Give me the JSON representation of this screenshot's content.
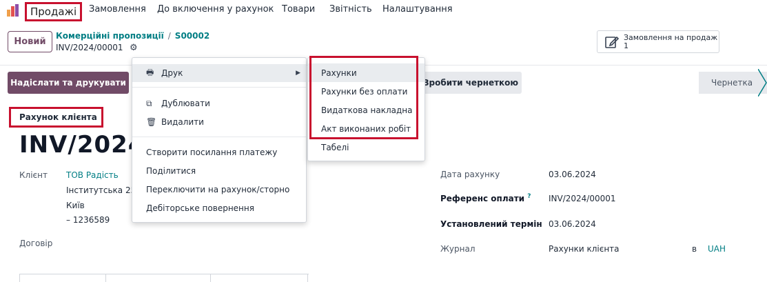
{
  "nav": {
    "app_name": "Продажі",
    "menu": [
      "Замовлення",
      "До включення у рахунок",
      "Товари",
      "Звітність",
      "Налаштування"
    ]
  },
  "control": {
    "new_label": "Новий",
    "breadcrumb_parent": "Комерційні пропозиції",
    "breadcrumb_separator": "/",
    "breadcrumb_current": "S00002",
    "record_name": "INV/2024/00001",
    "smart_button_label": "Замовлення на продаж",
    "smart_button_count": "1"
  },
  "actions": {
    "send_print": "Надіслати та друкувати",
    "reset_draft": "Зробити чернеткою",
    "status": "Чернетка"
  },
  "form": {
    "doc_type": "Рахунок клієнта",
    "title": "INV/2024/0",
    "customer_label": "Клієнт",
    "customer_name": "ТОВ Радість",
    "address_line1": "Інститутська 25",
    "address_line2": "Київ",
    "address_line3": "– 1236589",
    "contract_label": "Договір",
    "invoice_date_label": "Дата рахунку",
    "invoice_date": "03.06.2024",
    "payment_ref_label": "Референс оплати",
    "payment_ref_help": "?",
    "payment_ref": "INV/2024/00001",
    "due_date_label": "Установлений термін",
    "due_date": "03.06.2024",
    "journal_label": "Журнал",
    "journal": "Рахунки клієнта",
    "currency_prefix": "в",
    "currency": "UAH"
  },
  "dropdown": {
    "print": "Друк",
    "duplicate": "Дублювати",
    "delete": "Видалити",
    "payment_link": "Створити посилання платежу",
    "share": "Поділитися",
    "switch": "Переключити на рахунок/сторно",
    "refund": "Дебіторське повернення"
  },
  "submenu": [
    "Рахунки",
    "Рахунки без оплати",
    "Видаткова накладна",
    "Акт виконаних робіт",
    "Табелі"
  ],
  "colors": {
    "primary": "#714b67",
    "link": "#017e84",
    "highlight": "#c8102e"
  }
}
